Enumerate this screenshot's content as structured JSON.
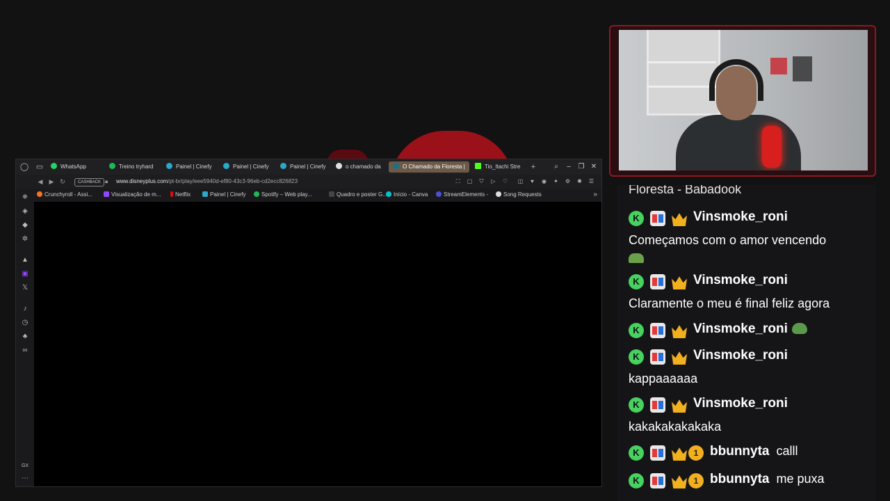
{
  "browser": {
    "tabs": [
      {
        "label": "WhatsApp",
        "color": "#25d366"
      },
      {
        "label": "Treino tryhard",
        "color": "#1db954"
      },
      {
        "label": "Painel | Cinefy",
        "color": "#2aa7c9"
      },
      {
        "label": "Painel | Cinefy",
        "color": "#2aa7c9"
      },
      {
        "label": "Painel | Cinefy",
        "color": "#2aa7c9"
      },
      {
        "label": "o chamado da",
        "color": "#e0e0e0"
      },
      {
        "label": "O Chamado da Floresta |",
        "color": "#1f6f87"
      },
      {
        "label": "Tio_Itachi Stre",
        "color": "#53fc18"
      }
    ],
    "cashback_label": "CASHBACK",
    "url_host": "www.disneyplus.com",
    "url_path": "/pt-br/play/eee5940d-ef80-43c3-96eb-cd2ecc826823",
    "bookmarks": [
      {
        "label": "Crunchyroll - Assi...",
        "color": "#f47521"
      },
      {
        "label": "Visualização de m...",
        "color": "#9147ff"
      },
      {
        "label": "Netflix",
        "color": "#e50914"
      },
      {
        "label": "Painel | Cinefy",
        "color": "#2aa7c9"
      },
      {
        "label": "Spotify – Web play...",
        "color": "#1db954"
      },
      {
        "label": "Quadro e poster G...",
        "color": "#444444"
      },
      {
        "label": "Início - Canva",
        "color": "#00c4cc"
      },
      {
        "label": "StreamElements -",
        "color": "#4b4fd6"
      },
      {
        "label": "Song Requests",
        "color": "#dddddd"
      }
    ]
  },
  "chat": {
    "partial_top": "Floresta - Babadook",
    "messages": [
      {
        "user": "Vinsmoke_roni",
        "text": "Começamos com o amor vencendo"
      },
      {
        "user": "Vinsmoke_roni",
        "text": "Claramente o meu é final feliz agora"
      },
      {
        "user": "Vinsmoke_roni",
        "text": ""
      },
      {
        "user": "Vinsmoke_roni",
        "text": "kappaaaaaa"
      },
      {
        "user": "Vinsmoke_roni",
        "text": "kakakakakakaka"
      },
      {
        "user": "bbunnyta",
        "text": "calll",
        "badge_number": "1"
      },
      {
        "user": "bbunnyta",
        "text": "me puxa",
        "badge_number": "1"
      }
    ]
  }
}
